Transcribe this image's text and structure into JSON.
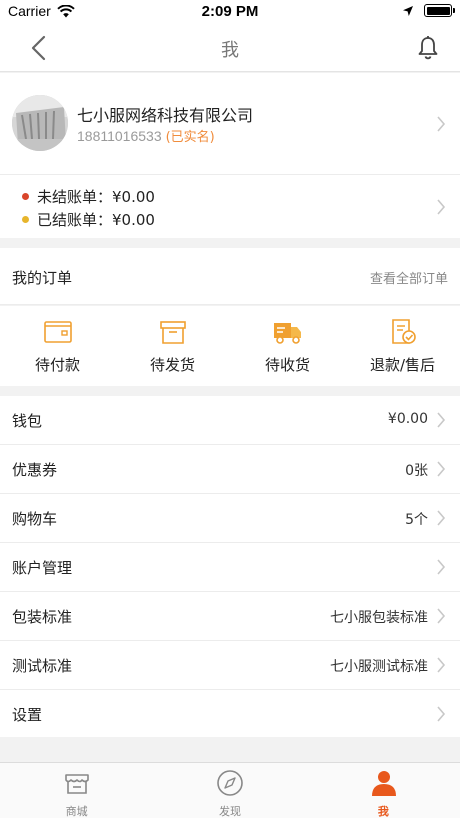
{
  "status_bar": {
    "carrier": "Carrier",
    "time": "2:09 PM"
  },
  "nav": {
    "title": "我"
  },
  "profile": {
    "company": "七小服网络科技有限公司",
    "phone": "18811016533",
    "verified": "(已实名)"
  },
  "bills": [
    {
      "label": "未结账单：¥0.00",
      "color": "#d9452b"
    },
    {
      "label": "已结账单：¥0.00",
      "color": "#e7b52c"
    }
  ],
  "orders": {
    "title": "我的订单",
    "view_all": "查看全部订单",
    "items": [
      {
        "label": "待付款",
        "icon": "wallet-icon"
      },
      {
        "label": "待发货",
        "icon": "box-icon"
      },
      {
        "label": "待收货",
        "icon": "truck-icon"
      },
      {
        "label": "退款/售后",
        "icon": "receipt-check-icon"
      }
    ]
  },
  "menu": [
    {
      "label": "钱包",
      "value": "¥0.00"
    },
    {
      "label": "优惠券",
      "value": "0张"
    },
    {
      "label": "购物车",
      "value": "5个"
    },
    {
      "label": "账户管理",
      "value": ""
    },
    {
      "label": "包装标准",
      "value": "七小服包装标准"
    },
    {
      "label": "测试标准",
      "value": "七小服测试标准"
    },
    {
      "label": "设置",
      "value": ""
    }
  ],
  "tabs": [
    {
      "label": "商城",
      "icon": "store-icon"
    },
    {
      "label": "发现",
      "icon": "compass-icon"
    },
    {
      "label": "我",
      "icon": "person-icon",
      "active": true
    }
  ],
  "colors": {
    "accent": "#f0a030",
    "active_tab": "#e8581c",
    "verified": "#f08c3c"
  }
}
